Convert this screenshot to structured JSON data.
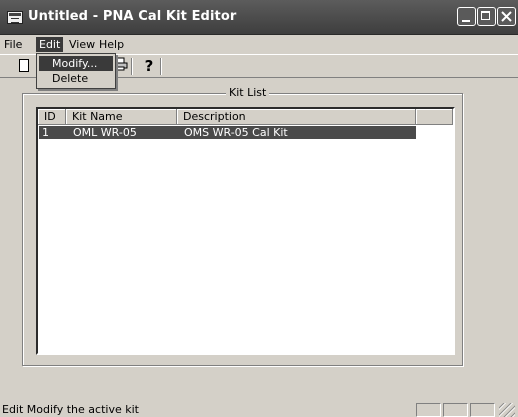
{
  "window": {
    "title": "Untitled - PNA Cal Kit Editor"
  },
  "menubar": {
    "items": [
      {
        "label": "File"
      },
      {
        "label": "Edit"
      },
      {
        "label": "View"
      },
      {
        "label": "Help"
      }
    ]
  },
  "toolbar": {
    "help_glyph": "?"
  },
  "edit_menu": {
    "items": [
      {
        "label": "Modify..."
      },
      {
        "label": "Delete"
      }
    ]
  },
  "kit_list": {
    "group_label": "Kit List",
    "columns": [
      "ID",
      "Kit Name",
      "Description"
    ],
    "rows": [
      {
        "id": "1",
        "name": "OML WR-05",
        "description": "OMS WR-05 Cal Kit"
      }
    ]
  },
  "statusbar": {
    "text": "Edit Modify the active kit"
  },
  "colors": {
    "titlebar": "#4a4a4a",
    "selection": "#3a3a3a",
    "face": "#d4d0c8"
  }
}
